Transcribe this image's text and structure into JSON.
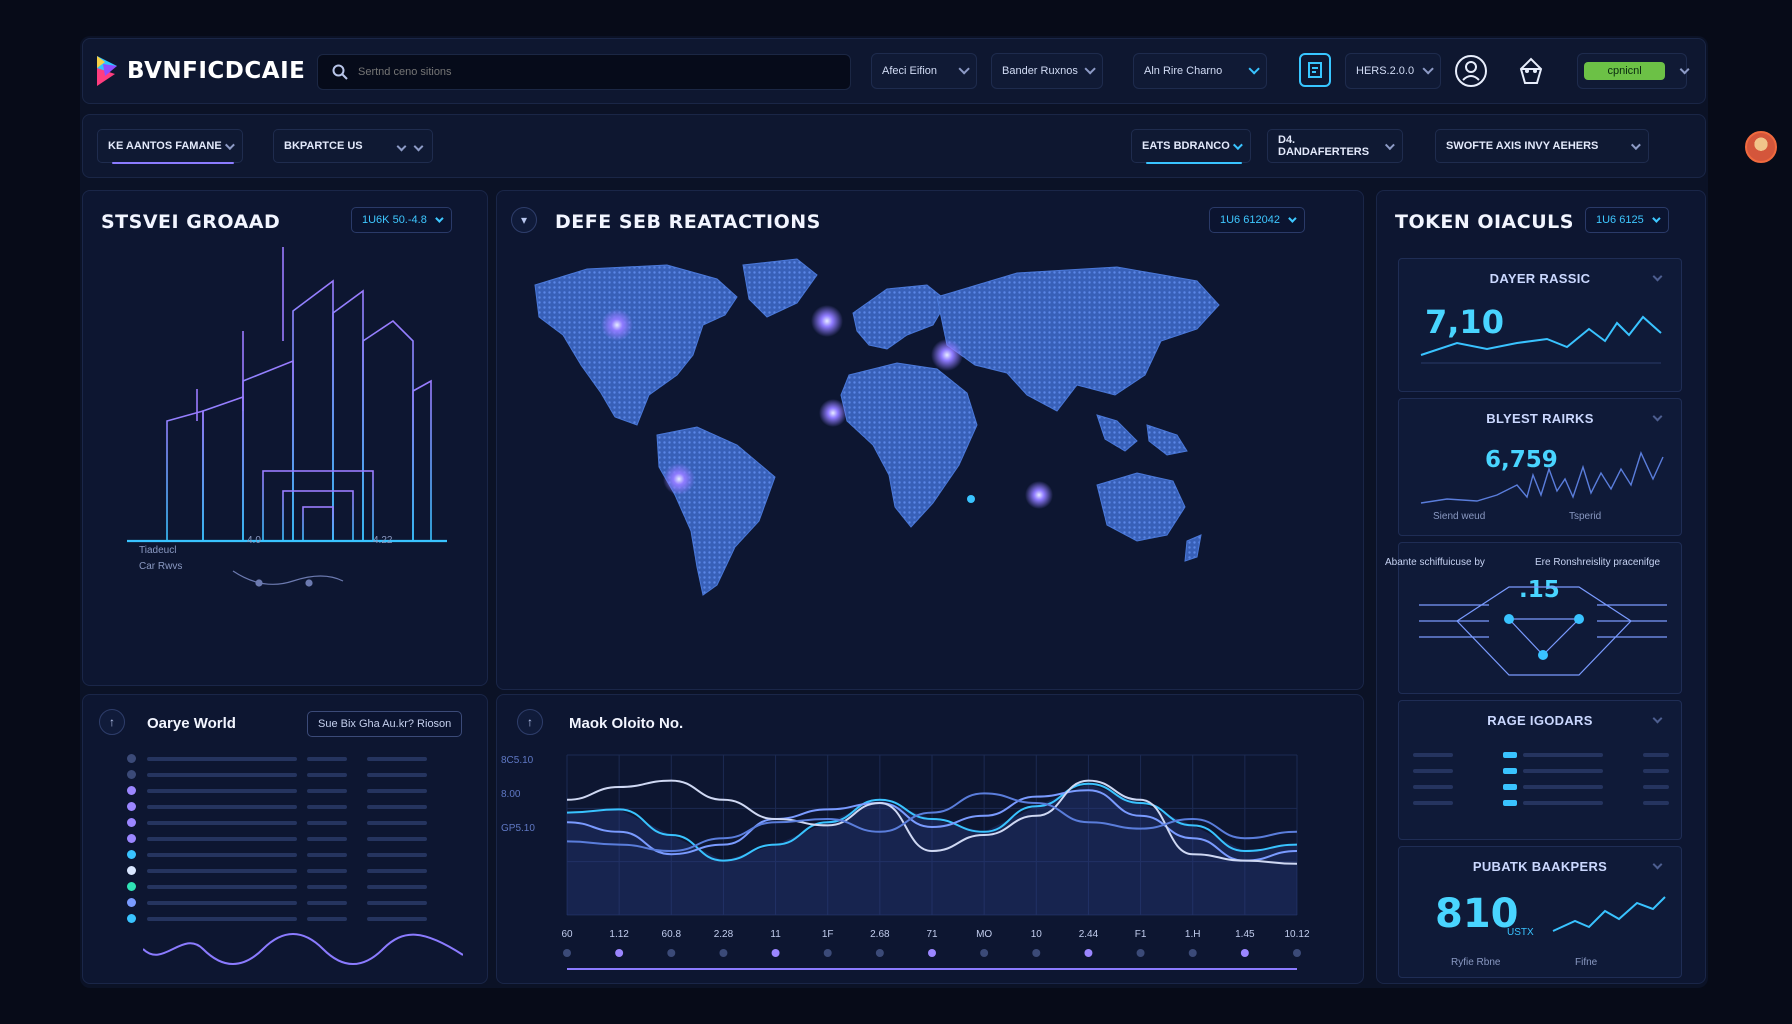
{
  "topbar": {
    "app_name": "BVNFICDCAIE",
    "search_placeholder": "Sertnd ceno sitions",
    "dropdown_1": "Afeci Eifion",
    "dropdown_2": "Bander Ruxnos",
    "dropdown_3": "Aln Rire Charno",
    "account": "HERS.2.0.0",
    "connect_label": "cpnicnl"
  },
  "subbar": {
    "tab_1": "KE AANTOS FAMANE",
    "tab_2": "BKPARTCE US",
    "tab_3": "EATS BDRANCO",
    "tab_4": "D4. DANDAFERTERS",
    "tab_5": "SWOFTE AXIS INVY AEHERS"
  },
  "left_panel": {
    "title": "STSVEI GROAAD",
    "badge": "1U6K 50.-4.8",
    "legend_1": "Tiadeucl",
    "legend_2": "Car Rwvs",
    "scale_left": "4.0",
    "scale_right": "4.22"
  },
  "map_panel": {
    "title": "DEFE SEB REATACTIONS",
    "badge": "1U6 612042"
  },
  "world_panel": {
    "title": "Oarye World",
    "button": "Sue Bix Gha Au.kr? Rioson"
  },
  "chart_panel": {
    "title": "Maok Oloito No."
  },
  "token_panel": {
    "title": "TOKEN OIACULS",
    "badge": "1U6 6125",
    "card_1_title": "DAYER RASSIC",
    "card_1_value": "7,10",
    "card_2_title": "BLYEST RAIRKS",
    "card_2_value": "6,759",
    "card_2_foot_left": "Siend weud",
    "card_2_foot_right": "Tsperid",
    "card_3_caption_left": "Abante schiffuicuse by",
    "card_3_caption_right": "Ere Ronshreislity pracenifge",
    "card_3_value": ".15",
    "card_4_title": "RAGE IGODARS",
    "card_5_title": "PUBATK BAAKPERS",
    "card_5_value": "810",
    "card_5_unit": "USTX",
    "card_5_foot_left": "Ryfie Rbne",
    "card_5_foot_right": "Fifne"
  },
  "chart_data": {
    "type": "line",
    "title": "Maok Oloito No.",
    "x": [
      "60",
      "1.12",
      "60.8",
      "2.28",
      "11",
      "1F",
      "2.68",
      "71",
      "MO",
      "10",
      "2.44",
      "F1",
      "1.H",
      "1.45",
      "10.12"
    ],
    "y_labels": [
      "8C5.10",
      "8.00",
      "GP5.10"
    ],
    "series": [
      {
        "color": "#39c3ff",
        "values": [
          64,
          66,
          50,
          34,
          44,
          58,
          72,
          60,
          52,
          68,
          82,
          70,
          56,
          40,
          44
        ]
      },
      {
        "color": "#7a9bff",
        "values": [
          58,
          52,
          38,
          44,
          60,
          66,
          70,
          55,
          62,
          74,
          78,
          62,
          48,
          34,
          40
        ]
      },
      {
        "color": "#cfd8f3",
        "values": [
          72,
          80,
          84,
          72,
          60,
          56,
          70,
          40,
          50,
          62,
          84,
          72,
          38,
          34,
          32
        ]
      },
      {
        "color": "#5a7ddb",
        "values": [
          46,
          44,
          40,
          48,
          58,
          60,
          52,
          64,
          76,
          70,
          58,
          54,
          60,
          48,
          52
        ]
      }
    ],
    "grid": true
  },
  "colors": {
    "background": "#070b18",
    "panel": "#0d1631",
    "accent_cyan": "#3ec7ff",
    "accent_violet": "#8b7bff",
    "success_green": "#6cc146"
  }
}
